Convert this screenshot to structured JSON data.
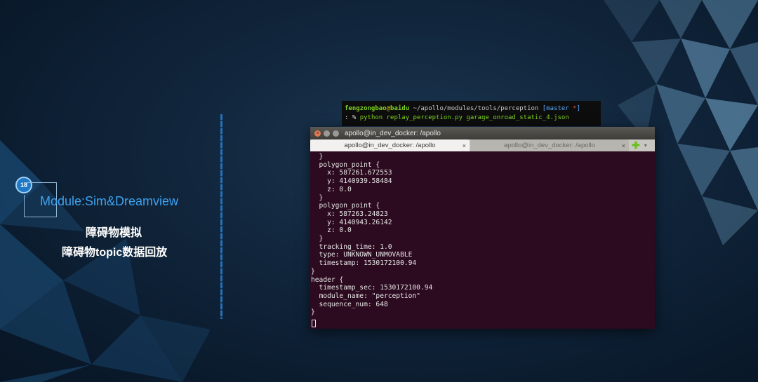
{
  "slide": {
    "badge_number": "18",
    "module_title": "Module:Sim&Dreamview",
    "subtitle_line1": "障碍物模拟",
    "subtitle_line2": "障碍物topic数据回放"
  },
  "shell_prompt": {
    "user": "fengzongbao",
    "at": "@",
    "host": "baidu",
    "path": " ~/apollo/modules/tools/perception ",
    "branch_open": "[",
    "branch": "master",
    "branch_mod": " *",
    "branch_close": "]",
    "prompt_symbol": ": % ",
    "command": "python replay_perception.py garage_onroad_static_4.json"
  },
  "terminal": {
    "window_title": "apollo@in_dev_docker: /apollo",
    "tabs": [
      {
        "label": "apollo@in_dev_docker: /apollo",
        "close": "×"
      },
      {
        "label": "apollo@in_dev_docker: /apollo",
        "close": "×"
      }
    ],
    "new_tab": "✚",
    "menu": "▾",
    "lines": [
      "  }",
      "  polygon_point {",
      "    x: 587261.672553",
      "    y: 4140939.58484",
      "    z: 0.0",
      "  }",
      "  polygon_point {",
      "    x: 587263.24823",
      "    y: 4140943.26142",
      "    z: 0.0",
      "  }",
      "  tracking_time: 1.0",
      "  type: UNKNOWN_UNMOVABLE",
      "  timestamp: 1530172100.94",
      "}",
      "header {",
      "  timestamp_sec: 1530172100.94",
      "  module_name: \"perception\"",
      "  sequence_num: 648",
      "}"
    ]
  }
}
